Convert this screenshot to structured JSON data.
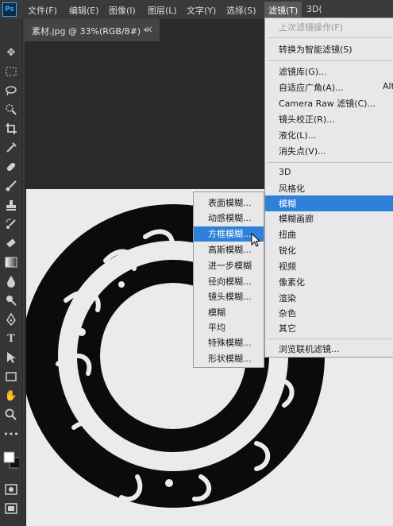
{
  "app": {
    "logo": "Ps"
  },
  "menubar": {
    "items": [
      "文件(F)",
      "编辑(E)",
      "图像(I)",
      "图层(L)",
      "文字(Y)",
      "选择(S)",
      "滤镜(T)",
      "3D("
    ]
  },
  "document_tab": {
    "title": "素材.jpg @ 33%(RGB/8#) *",
    "close": "×"
  },
  "filter_menu": {
    "items": [
      "上次滤镜操作(F)",
      "转换为智能滤镜(S)",
      "滤镜库(G)...",
      "自适应广角(A)...",
      "Camera Raw 滤镜(C)...",
      "镜头校正(R)...",
      "液化(L)...",
      "消失点(V)...",
      "3D",
      "风格化",
      "模糊",
      "模糊画廊",
      "扭曲",
      "锐化",
      "视频",
      "像素化",
      "渲染",
      "杂色",
      "其它",
      "浏览联机滤镜..."
    ],
    "shortcut_fragment": "Alt"
  },
  "blur_submenu": {
    "items": [
      "表面模糊...",
      "动感模糊...",
      "方框模糊...",
      "高斯模糊...",
      "进一步模糊",
      "径向模糊...",
      "镜头模糊...",
      "模糊",
      "平均",
      "特殊模糊...",
      "形状模糊..."
    ]
  },
  "tools": [
    "move-tool-icon",
    "marquee-tool-icon",
    "lasso-tool-icon",
    "quick-select-tool-icon",
    "crop-tool-icon",
    "eyedropper-tool-icon",
    "healing-brush-tool-icon",
    "brush-tool-icon",
    "clone-stamp-tool-icon",
    "history-brush-tool-icon",
    "eraser-tool-icon",
    "gradient-tool-icon",
    "blur-tool-icon",
    "dodge-tool-icon",
    "pen-tool-icon",
    "type-tool-icon",
    "path-select-tool-icon",
    "rectangle-tool-icon",
    "hand-tool-icon",
    "zoom-tool-icon",
    "more-tools-icon",
    "color-swatches-icon",
    "quick-mask-icon",
    "screen-mode-icon"
  ],
  "colors": {
    "selection": "#2f80d9",
    "menu_bg": "#e8e8e8",
    "ui_dark": "#2a2a2a",
    "logo_blue": "#31a8ff"
  }
}
